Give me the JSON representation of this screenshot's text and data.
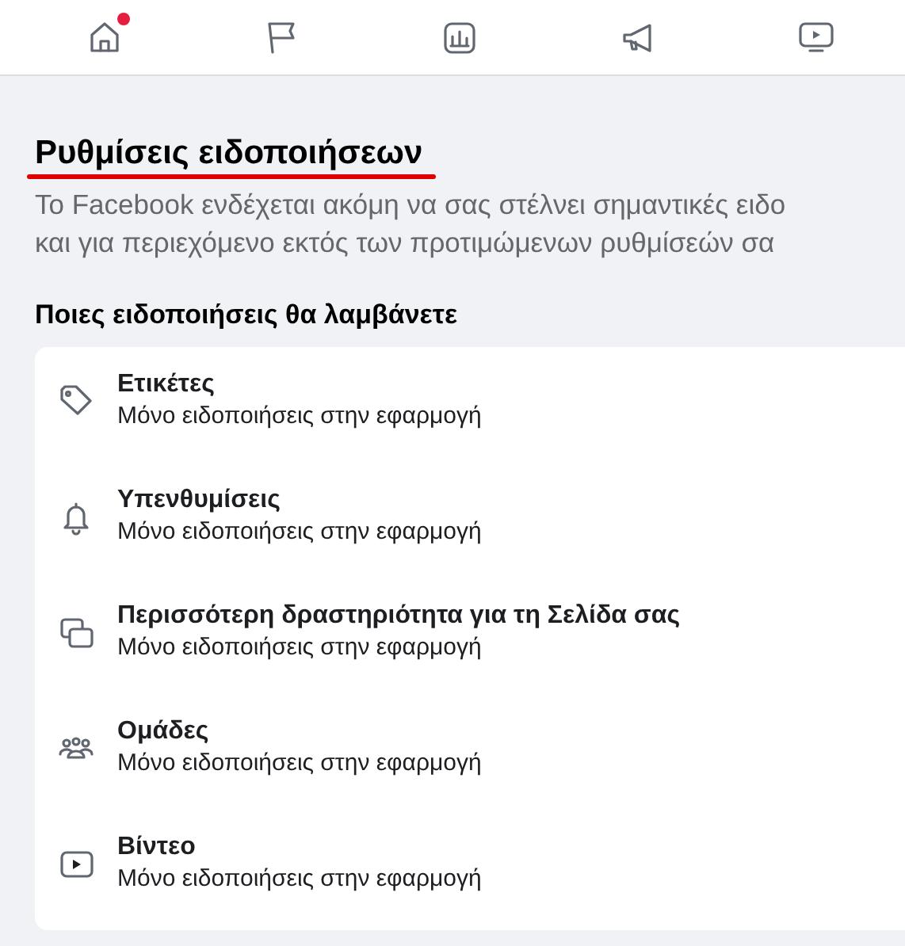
{
  "nav": [
    {
      "kind": "home",
      "badge": true
    },
    {
      "kind": "flag",
      "badge": false
    },
    {
      "kind": "insights",
      "badge": false
    },
    {
      "kind": "megaphone",
      "badge": false
    },
    {
      "kind": "video",
      "badge": false
    }
  ],
  "page": {
    "title": "Ρυθμίσεις ειδοποιήσεων",
    "description": [
      "Το Facebook ενδέχεται ακόμη να σας στέλνει σημαντικές ειδο",
      "και για περιεχόμενο εκτός των προτιμώμενων ρυθμίσεών σα"
    ]
  },
  "section": {
    "heading": "Ποιες ειδοποιήσεις θα λαμβάνετε",
    "items": [
      {
        "kind": "tag",
        "title": "Ετικέτες",
        "subtitle": "Μόνο ειδοποιήσεις στην εφαρμογή"
      },
      {
        "kind": "bell",
        "title": "Υπενθυμίσεις",
        "subtitle": "Μόνο ειδοποιήσεις στην εφαρμογή"
      },
      {
        "kind": "pages",
        "title": "Περισσότερη δραστηριότητα για τη Σελίδα σας",
        "subtitle": "Μόνο ειδοποιήσεις στην εφαρμογή"
      },
      {
        "kind": "groups",
        "title": "Ομάδες",
        "subtitle": "Μόνο ειδοποιήσεις στην εφαρμογή"
      },
      {
        "kind": "video",
        "title": "Βίντεο",
        "subtitle": "Μόνο ειδοποιήσεις στην εφαρμογή"
      }
    ]
  }
}
